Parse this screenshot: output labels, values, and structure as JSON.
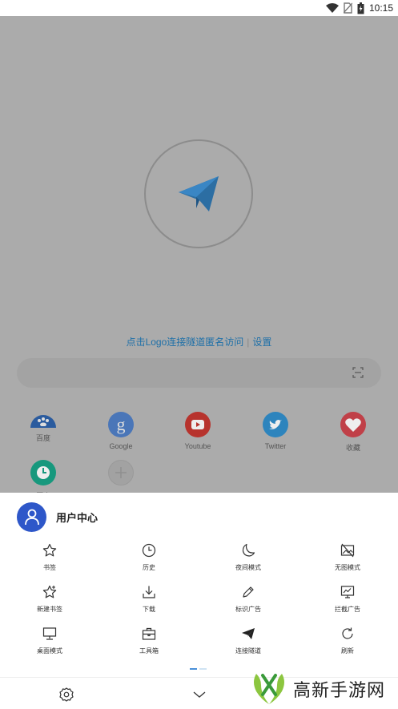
{
  "status_bar": {
    "time": "10:15"
  },
  "home": {
    "hint_link": "点击Logo连接隧道匿名访问",
    "hint_separator": "|",
    "hint_settings": "设置",
    "shortcuts": [
      {
        "label": "百度",
        "icon": "baidu-paw-icon",
        "color": "#2a5b9e"
      },
      {
        "label": "Google",
        "icon": "google-g-icon",
        "color": "#3a6fc4"
      },
      {
        "label": "Youtube",
        "icon": "youtube-play-icon",
        "color": "#c3322b"
      },
      {
        "label": "Twitter",
        "icon": "twitter-bird-icon",
        "color": "#2a89c4"
      },
      {
        "label": "收藏",
        "icon": "heart-icon",
        "color": "#c33a48"
      },
      {
        "label": "历史",
        "icon": "clock-icon",
        "color": "#1c9a7f"
      }
    ],
    "accent_color": "#1d6fa8"
  },
  "sheet": {
    "user_center": "用户中心",
    "menu": [
      {
        "label": "书签",
        "icon": "star-icon"
      },
      {
        "label": "历史",
        "icon": "clock-icon"
      },
      {
        "label": "夜间模式",
        "icon": "moon-icon"
      },
      {
        "label": "无图模式",
        "icon": "no-image-icon"
      },
      {
        "label": "新建书签",
        "icon": "star-plus-icon"
      },
      {
        "label": "下载",
        "icon": "download-icon"
      },
      {
        "label": "标识广告",
        "icon": "pencil-icon"
      },
      {
        "label": "拦截广告",
        "icon": "block-ad-icon"
      },
      {
        "label": "桌面模式",
        "icon": "desktop-icon"
      },
      {
        "label": "工具箱",
        "icon": "toolbox-icon"
      },
      {
        "label": "连接隧道",
        "icon": "send-icon"
      },
      {
        "label": "刷新",
        "icon": "refresh-icon"
      }
    ]
  },
  "watermark": {
    "text": "高新手游网"
  }
}
